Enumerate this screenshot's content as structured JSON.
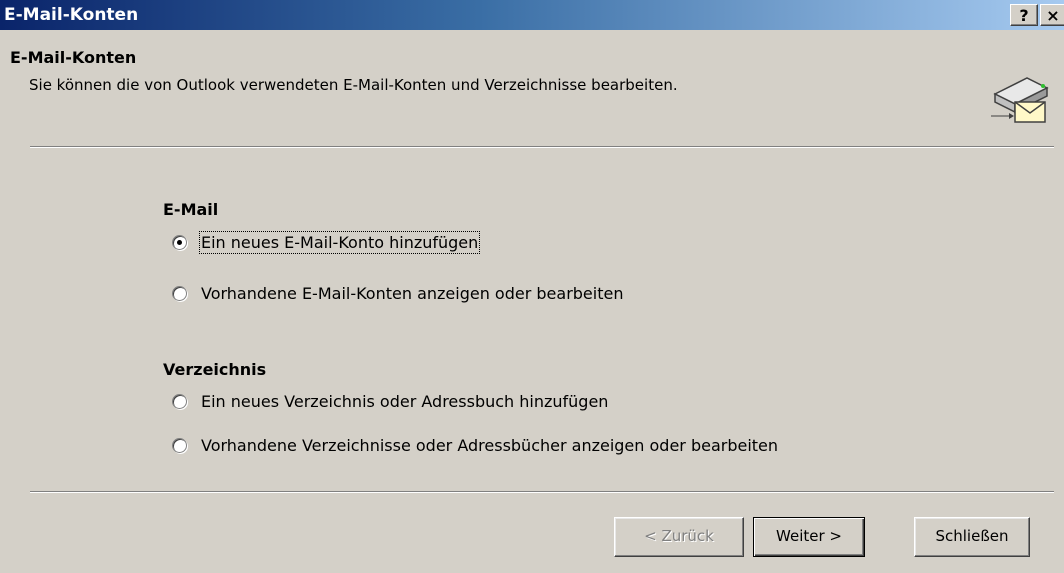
{
  "window": {
    "title": "E-Mail-Konten",
    "help_label": "?",
    "close_label": "×"
  },
  "header": {
    "title": "E-Mail-Konten",
    "subtitle": "Sie können die von Outlook verwendeten E-Mail-Konten und Verzeichnisse bearbeiten.",
    "icon": "mail-server-icon"
  },
  "email_group": {
    "label": "E-Mail",
    "options": [
      {
        "label": "Ein neues E-Mail-Konto hinzufügen",
        "checked": true
      },
      {
        "label": "Vorhandene E-Mail-Konten anzeigen oder bearbeiten",
        "checked": false
      }
    ]
  },
  "directory_group": {
    "label": "Verzeichnis",
    "options": [
      {
        "label": "Ein neues Verzeichnis oder Adressbuch hinzufügen",
        "checked": false
      },
      {
        "label": "Vorhandene Verzeichnisse oder Adressbücher anzeigen oder bearbeiten",
        "checked": false
      }
    ]
  },
  "buttons": {
    "back": "< Zurück",
    "next": "Weiter >",
    "close": "Schließen"
  }
}
